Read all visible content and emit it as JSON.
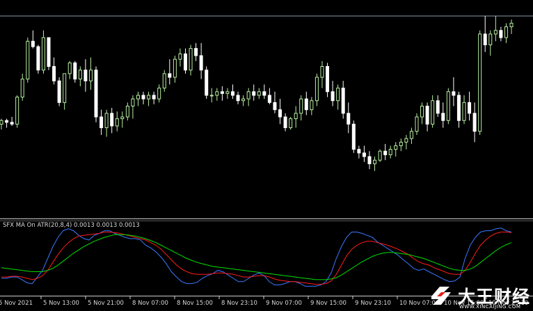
{
  "chart_data": [
    {
      "type": "candlestick",
      "title": "",
      "ylim": [
        0,
        100
      ],
      "grid": false,
      "colors": {
        "background": "#000000",
        "bull": "#b8f0a0",
        "bear": "#ffffff",
        "bid_line": "#8c9aa8"
      },
      "bid_level": 96.5,
      "candles": [
        [
          40,
          43,
          37,
          42
        ],
        [
          42,
          43,
          38,
          41
        ],
        [
          41,
          44,
          39,
          40
        ],
        [
          40,
          56,
          38,
          55
        ],
        [
          55,
          68,
          53,
          65
        ],
        [
          65,
          88,
          63,
          86
        ],
        [
          86,
          92,
          82,
          83
        ],
        [
          83,
          84,
          68,
          70
        ],
        [
          70,
          92,
          68,
          88
        ],
        [
          88,
          88,
          70,
          72
        ],
        [
          72,
          77,
          62,
          64
        ],
        [
          64,
          66,
          50,
          52
        ],
        [
          52,
          68,
          48,
          68
        ],
        [
          68,
          75,
          65,
          74
        ],
        [
          74,
          75,
          63,
          65
        ],
        [
          65,
          72,
          61,
          70
        ],
        [
          70,
          76,
          58,
          64
        ],
        [
          64,
          77,
          59,
          70
        ],
        [
          70,
          72,
          41,
          44
        ],
        [
          44,
          48,
          34,
          38
        ],
        [
          38,
          48,
          33,
          46
        ],
        [
          46,
          49,
          35,
          39
        ],
        [
          39,
          47,
          36,
          43
        ],
        [
          43,
          47,
          38,
          44
        ],
        [
          44,
          52,
          42,
          50
        ],
        [
          50,
          56,
          43,
          54
        ],
        [
          54,
          58,
          50,
          56
        ],
        [
          56,
          58,
          51,
          54
        ],
        [
          54,
          58,
          50,
          56
        ],
        [
          56,
          58,
          51,
          54
        ],
        [
          54,
          62,
          52,
          60
        ],
        [
          60,
          70,
          58,
          68
        ],
        [
          68,
          76,
          62,
          66
        ],
        [
          66,
          78,
          63,
          76
        ],
        [
          76,
          82,
          72,
          79
        ],
        [
          79,
          82,
          68,
          70
        ],
        [
          70,
          84,
          67,
          82
        ],
        [
          82,
          85,
          75,
          78
        ],
        [
          78,
          85,
          65,
          70
        ],
        [
          70,
          72,
          54,
          56
        ],
        [
          56,
          60,
          52,
          56
        ],
        [
          56,
          60,
          53,
          58
        ],
        [
          58,
          61,
          53,
          57
        ],
        [
          57,
          60,
          54,
          58
        ],
        [
          58,
          62,
          54,
          56
        ],
        [
          56,
          58,
          51,
          53
        ],
        [
          53,
          56,
          50,
          54
        ],
        [
          54,
          60,
          50,
          58
        ],
        [
          58,
          62,
          53,
          56
        ],
        [
          56,
          60,
          54,
          58
        ],
        [
          58,
          62,
          54,
          56
        ],
        [
          56,
          60,
          51,
          52
        ],
        [
          52,
          58,
          46,
          48
        ],
        [
          48,
          54,
          40,
          44
        ],
        [
          44,
          46,
          36,
          38
        ],
        [
          38,
          44,
          37,
          43
        ],
        [
          43,
          50,
          38,
          46
        ],
        [
          46,
          56,
          42,
          54
        ],
        [
          54,
          58,
          45,
          48
        ],
        [
          48,
          55,
          45,
          53
        ],
        [
          53,
          68,
          50,
          66
        ],
        [
          66,
          75,
          60,
          72
        ],
        [
          72,
          74,
          55,
          58
        ],
        [
          58,
          64,
          50,
          53
        ],
        [
          53,
          62,
          48,
          60
        ],
        [
          60,
          64,
          43,
          46
        ],
        [
          46,
          52,
          35,
          40
        ],
        [
          40,
          42,
          24,
          26
        ],
        [
          26,
          28,
          21,
          24
        ],
        [
          24,
          28,
          19,
          22
        ],
        [
          22,
          25,
          15,
          18
        ],
        [
          18,
          22,
          14,
          20
        ],
        [
          20,
          26,
          19,
          25
        ],
        [
          25,
          29,
          20,
          23
        ],
        [
          23,
          28,
          21,
          26
        ],
        [
          26,
          30,
          22,
          28
        ],
        [
          28,
          32,
          25,
          30
        ],
        [
          30,
          34,
          26,
          32
        ],
        [
          32,
          38,
          29,
          36
        ],
        [
          36,
          46,
          34,
          44
        ],
        [
          44,
          52,
          40,
          50
        ],
        [
          50,
          52,
          36,
          40
        ],
        [
          40,
          56,
          38,
          53
        ],
        [
          53,
          56,
          44,
          46
        ],
        [
          46,
          52,
          38,
          42
        ],
        [
          42,
          60,
          40,
          58
        ],
        [
          58,
          66,
          50,
          56
        ],
        [
          56,
          58,
          38,
          42
        ],
        [
          42,
          56,
          40,
          52
        ],
        [
          52,
          58,
          42,
          46
        ],
        [
          46,
          52,
          30,
          36
        ],
        [
          36,
          92,
          34,
          90
        ],
        [
          90,
          100,
          80,
          84
        ],
        [
          84,
          92,
          78,
          90
        ],
        [
          90,
          100,
          86,
          92
        ],
        [
          92,
          94,
          86,
          88
        ],
        [
          88,
          96,
          85,
          94
        ],
        [
          94,
          98,
          90,
          96
        ]
      ]
    },
    {
      "type": "line",
      "title": "SFX MA On ATR(20,8,4) 0.0013 0.0013 0.0013",
      "ylim": [
        0,
        100
      ],
      "grid": false,
      "series": [
        {
          "color": "#3a78ff",
          "values": [
            20,
            20,
            22,
            22,
            18,
            13,
            12,
            22,
            32,
            50,
            68,
            82,
            92,
            95,
            92,
            85,
            80,
            78,
            85,
            88,
            92,
            92,
            88,
            85,
            82,
            80,
            80,
            78,
            70,
            66,
            60,
            52,
            42,
            30,
            22,
            15,
            12,
            12,
            14,
            20,
            24,
            27,
            32,
            30,
            25,
            20,
            15,
            15,
            20,
            25,
            28,
            24,
            15,
            10,
            10,
            12,
            15,
            15,
            12,
            8,
            8,
            8,
            10,
            15,
            28,
            50,
            68,
            82,
            90,
            90,
            88,
            85,
            82,
            75,
            70,
            65,
            60,
            55,
            48,
            42,
            35,
            32,
            34,
            30,
            26,
            22,
            18,
            15,
            16,
            22,
            50,
            70,
            82,
            90,
            92,
            92,
            95,
            96,
            92,
            90
          ]
        },
        {
          "color": "#ff1a1a",
          "values": [
            22,
            22,
            23,
            23,
            22,
            20,
            18,
            20,
            24,
            32,
            44,
            56,
            66,
            74,
            80,
            84,
            85,
            86,
            87,
            88,
            90,
            90,
            89,
            88,
            86,
            84,
            82,
            80,
            78,
            74,
            70,
            64,
            56,
            48,
            40,
            34,
            30,
            27,
            26,
            26,
            26,
            27,
            28,
            28,
            27,
            26,
            24,
            22,
            22,
            23,
            24,
            24,
            22,
            19,
            17,
            16,
            15,
            15,
            14,
            13,
            12,
            11,
            11,
            12,
            16,
            26,
            40,
            54,
            64,
            70,
            74,
            76,
            76,
            74,
            72,
            70,
            67,
            64,
            60,
            56,
            50,
            45,
            42,
            40,
            36,
            33,
            30,
            27,
            26,
            26,
            32,
            44,
            58,
            70,
            78,
            84,
            88,
            90,
            90,
            89
          ]
        },
        {
          "color": "#00e000",
          "values": [
            36,
            35,
            34,
            33,
            32,
            31,
            30,
            30,
            30,
            32,
            35,
            40,
            46,
            52,
            58,
            63,
            68,
            72,
            76,
            79,
            82,
            84,
            86,
            86,
            86,
            85,
            84,
            82,
            80,
            77,
            74,
            70,
            66,
            62,
            58,
            54,
            50,
            47,
            44,
            42,
            40,
            38,
            37,
            36,
            35,
            34,
            33,
            32,
            31,
            30,
            29,
            28,
            27,
            26,
            25,
            24,
            23,
            22,
            21,
            20,
            19,
            18,
            18,
            18,
            19,
            21,
            25,
            30,
            35,
            40,
            45,
            49,
            53,
            56,
            58,
            59,
            59,
            58,
            57,
            56,
            54,
            52,
            50,
            47,
            44,
            41,
            38,
            35,
            33,
            32,
            32,
            34,
            38,
            44,
            50,
            56,
            62,
            67,
            71,
            74
          ]
        }
      ]
    }
  ],
  "indicator_label": "SFX MA On ATR(20,8,4) 0.0013 0.0013 0.0013",
  "time_axis": {
    "labels": [
      "5 Nov 2021",
      "5 Nov 13:00",
      "5 Nov 21:00",
      "8 Nov 07:00",
      "8 Nov 15:00",
      "8 Nov 23:10",
      "9 Nov 07:00",
      "9 Nov 15:00",
      "9 Nov 23:10",
      "10 Nov 07:00",
      "10 Nov 15:00",
      "10 Nov 23:10"
    ]
  },
  "watermark": {
    "brand": "大王财经",
    "url": "WWW.XINCAIJING.COM",
    "icon": "ribbon-logo-icon"
  }
}
